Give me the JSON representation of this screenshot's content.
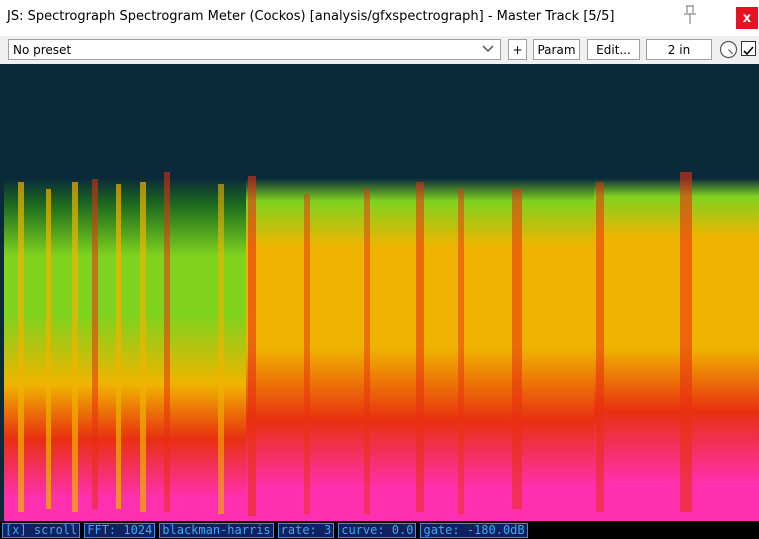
{
  "window": {
    "title": "JS: Spectrograph Spectrogram Meter (Cockos) [analysis/gfxspectrograph] - Master Track [5/5]",
    "pin_icon": "pin-icon",
    "close_label": "x",
    "close_color": "#e81123"
  },
  "toolbar": {
    "preset_value": "No preset",
    "preset_icon": "chevron-down-icon",
    "add_label": "+",
    "param_label": "Param",
    "edit_label": "Edit...",
    "io_label": "2 in",
    "knob_icon": "wet-knob-icon",
    "enabled": true
  },
  "spectrogram": {
    "colors": {
      "background": "#0a2a3a",
      "low": "#1e6d1e",
      "mid": "#7fd21e",
      "high": "#f0b400",
      "hot": "#e83010",
      "peak": "#ff30b0"
    }
  },
  "status": {
    "items": [
      "[x] scroll",
      "FFT: 1024",
      "blackman-harris",
      "rate: 3",
      "curve: 0.0",
      "gate: -180.0dB"
    ],
    "text_color": "#3fa9f5",
    "background": "#102060"
  }
}
